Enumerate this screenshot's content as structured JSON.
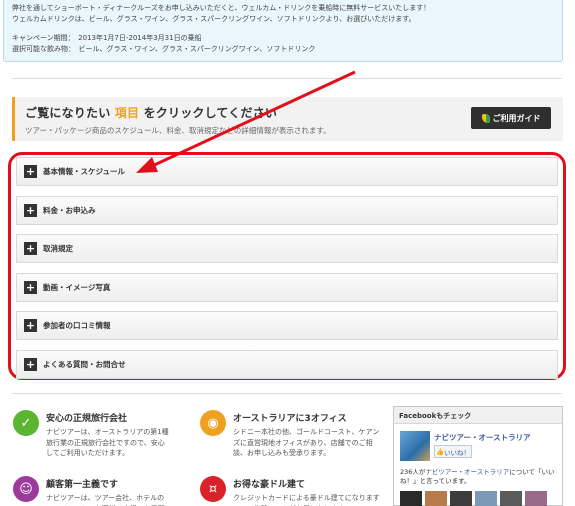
{
  "notice": {
    "line1": "弊社を通してショーボート・ディナークルーズをお申し込みいただくと、ウェルカム・ドリンクを乗船時に無料サービスいたします！",
    "line2": "ウェルカムドリンクは、ビール、グラス・ワイン、グラス・スパークリングワイン、ソフトドリンクより、お選びいただけます。",
    "line3": "キャンペーン期間：　2013年1月7日-2014年3月31日の乗船",
    "line4": "選択可能な飲み物：　ビール、グラス・ワイン、グラス・スパークリングワイン、ソフトドリンク"
  },
  "guide": {
    "title_prefix": "ご覧になりたい",
    "title_highlight": "項目",
    "title_suffix": "をクリックしてください",
    "subtitle": "ツアー・パッケージ商品のスケジュール、料金、取消規定などの詳細情報が表示されます。",
    "button_label": "ご利用ガイド"
  },
  "accordion": [
    {
      "label": "基本情報・スケジュール"
    },
    {
      "label": "料金・お申込み"
    },
    {
      "label": "取消規定"
    },
    {
      "label": "動画・イメージ写真"
    },
    {
      "label": "参加者の口コミ情報"
    },
    {
      "label": "よくある質問・お問合せ"
    }
  ],
  "features": [
    {
      "title": "安心の正規旅行会社",
      "desc": "ナビツアーは、オーストラリアの第1種旅行業の正規旅行会社ですので、安心してご利用いただけます。",
      "color": "#5cb531",
      "icon": "thumbs-up-icon"
    },
    {
      "title": "オーストラリアに3オフィス",
      "desc": "シドニー本社の他、ゴールドコースト、ケアンズに直営現地オフィスがあり、店舗でのご相談、お申し込みも受承ります。",
      "color": "#f0a020",
      "icon": "globe-icon"
    },
    {
      "title": "顧客第一主義です",
      "desc": "ナビツアーは、ツアー会社、ホテルのエージェント、お客様の立場でお手配します。",
      "color": "#9b3a9a",
      "icon": "people-icon"
    },
    {
      "title": "お得な豪ドル建て",
      "desc": "クレジットカードによる豪ドル建てになりますので、為替レートがお得になります。",
      "color": "#d9232a",
      "icon": "money-icon"
    }
  ],
  "facebook": {
    "header": "Facebookもチェック",
    "page_name": "ナビツアー・オーストラリア",
    "like_label": "いいね！",
    "count_number": "236人が",
    "count_link": "ナビツアー・オーストラリア",
    "count_suffix": "について「いいね！」と言っています。"
  }
}
